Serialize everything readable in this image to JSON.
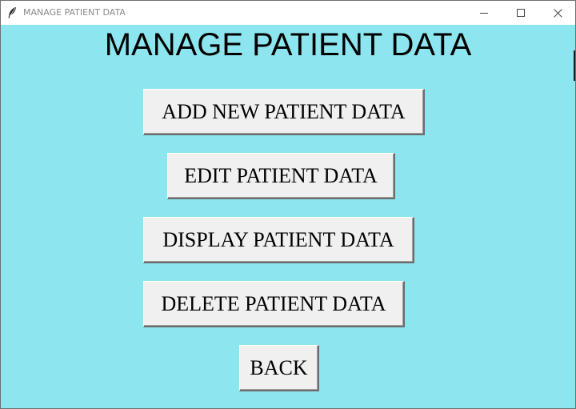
{
  "window": {
    "title": "MANAGE PATIENT DATA",
    "icon": "feather-icon",
    "controls": {
      "minimize_icon": "minimize-icon",
      "maximize_icon": "maximize-icon",
      "close_icon": "close-icon"
    }
  },
  "main": {
    "heading": "MANAGE PATIENT DATA",
    "buttons": {
      "add": "ADD NEW PATIENT DATA",
      "edit": "EDIT PATIENT DATA",
      "display": "DISPLAY PATIENT DATA",
      "delete": "DELETE PATIENT DATA",
      "back": "BACK"
    }
  },
  "colors": {
    "background": "#8de5ef",
    "button_face": "#f0f0f0",
    "title_text": "#8a8a8a"
  }
}
